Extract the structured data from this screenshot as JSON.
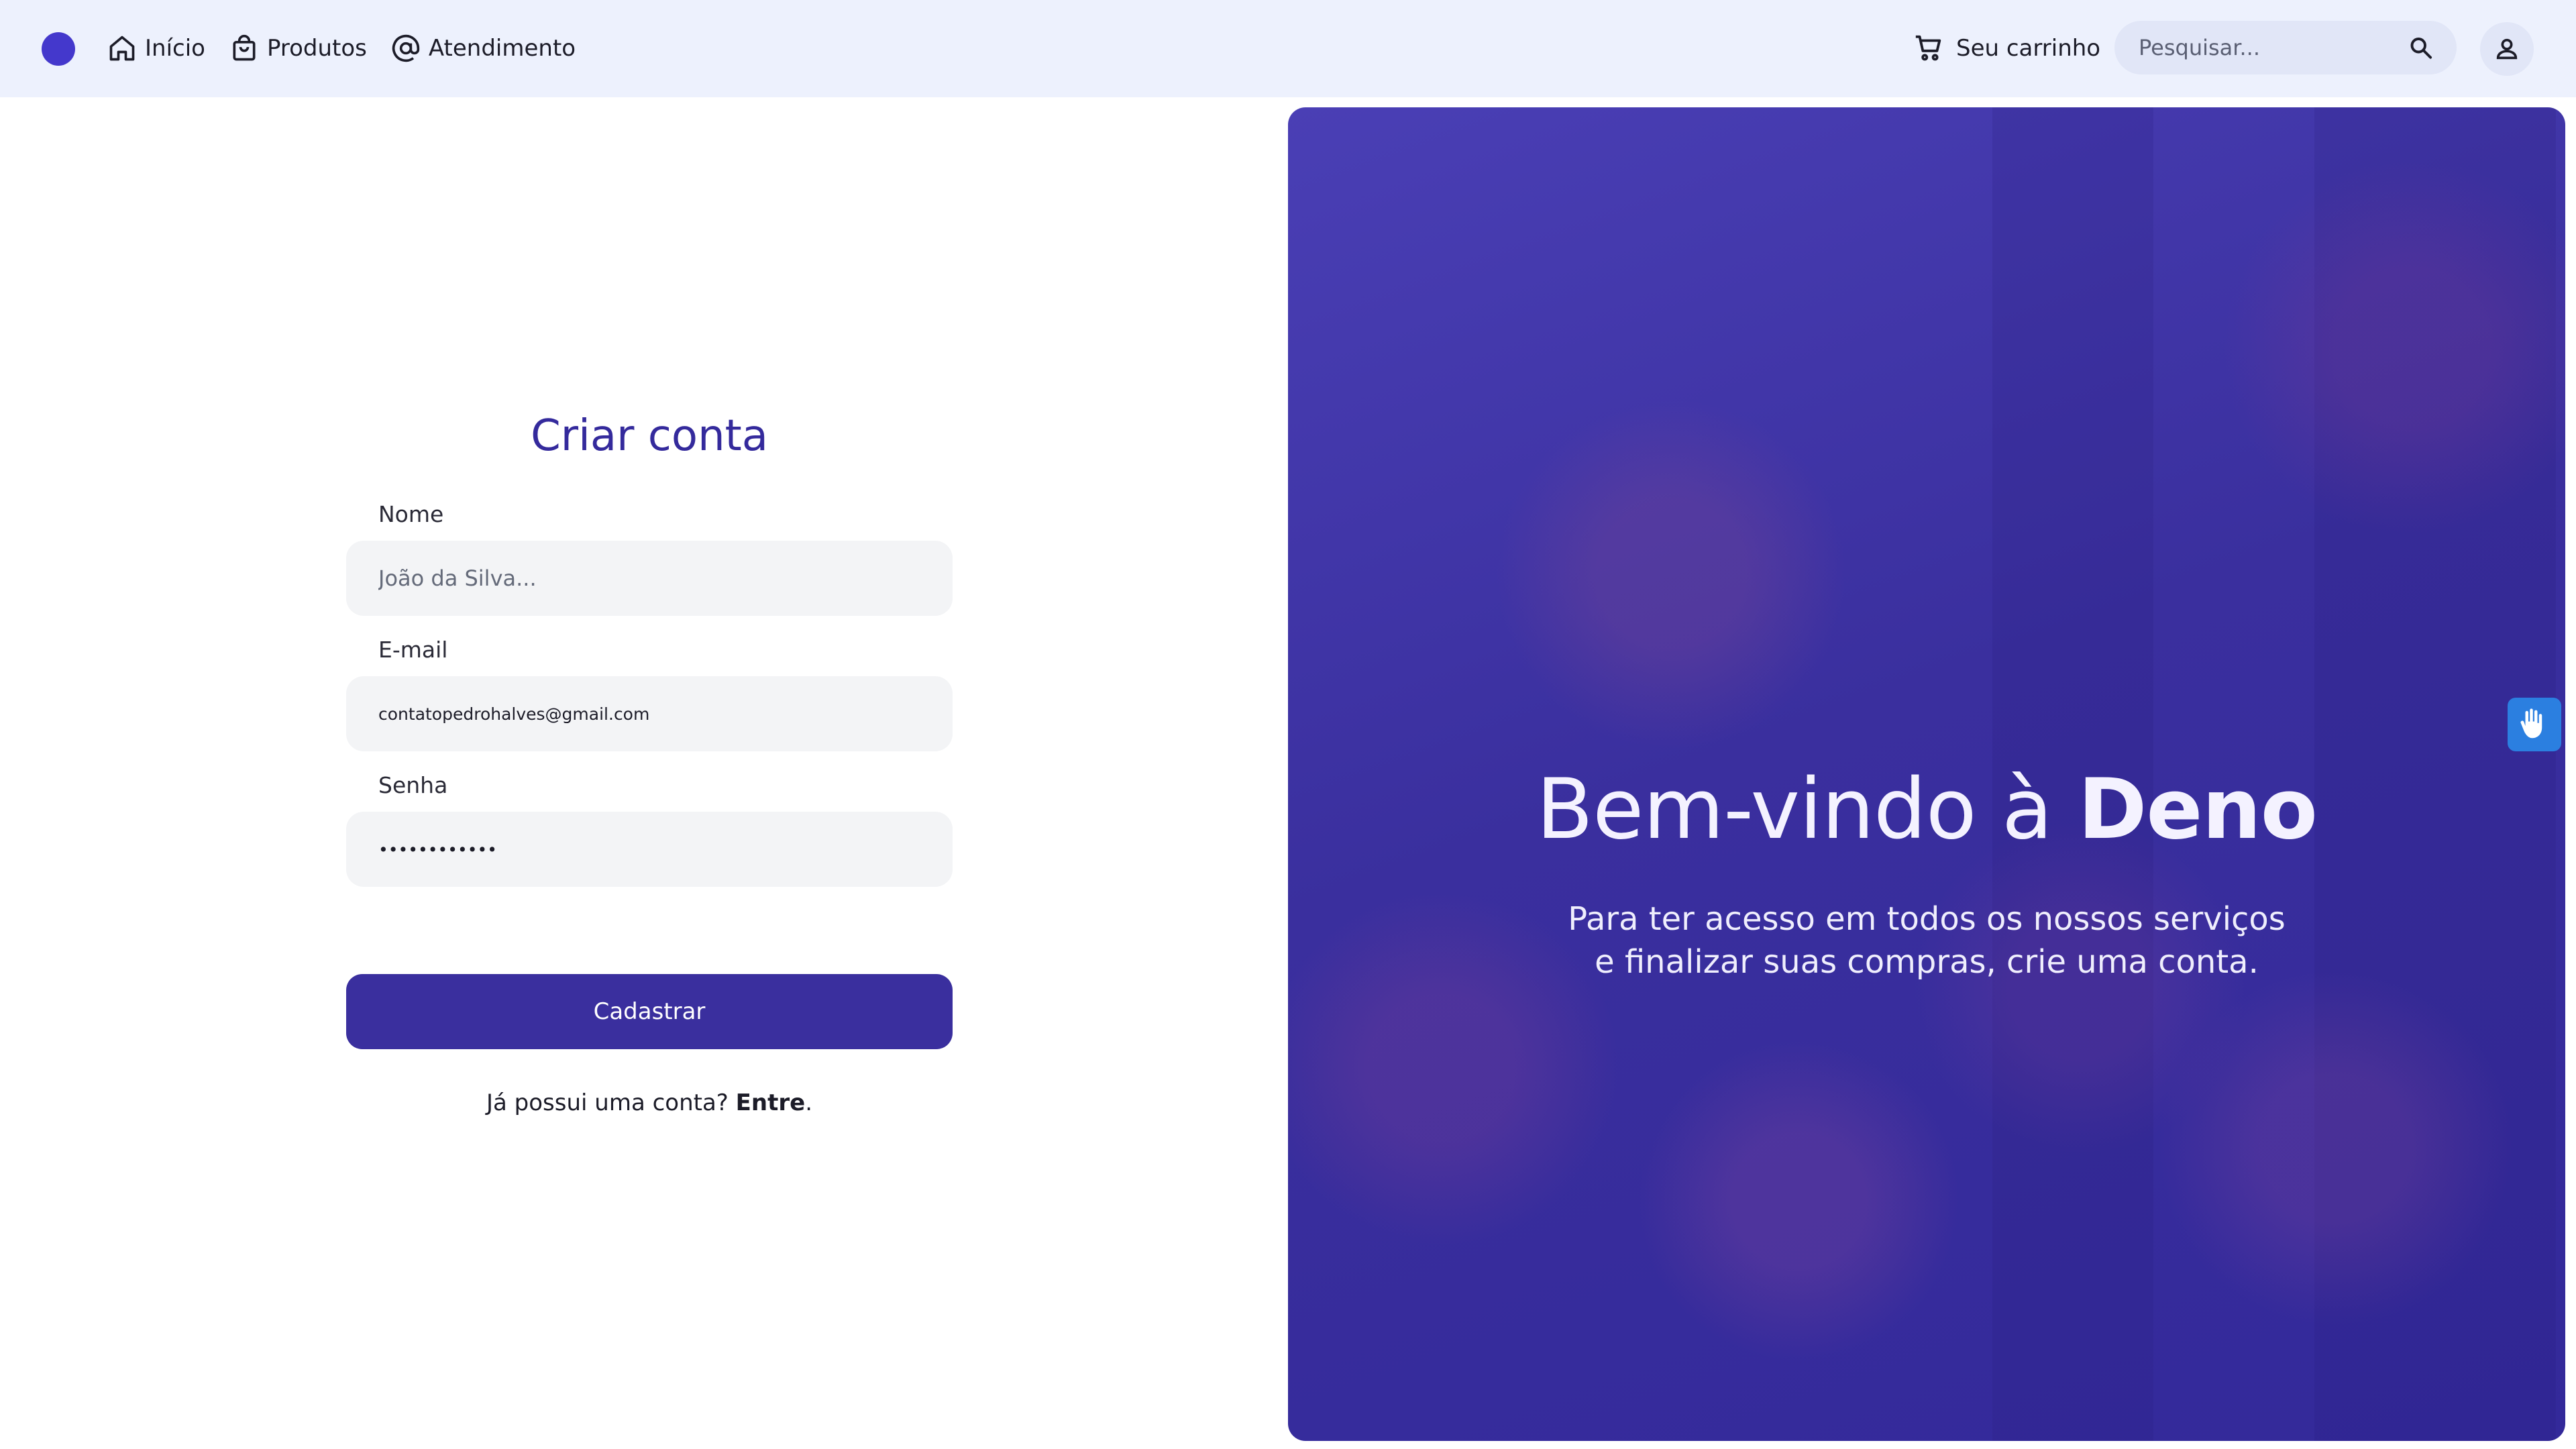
{
  "header": {
    "nav": [
      {
        "label": "Início",
        "icon": "home-icon"
      },
      {
        "label": "Produtos",
        "icon": "shopping-bag-icon"
      },
      {
        "label": "Atendimento",
        "icon": "at-sign-icon"
      }
    ],
    "cart_label": "Seu carrinho",
    "search_placeholder": "Pesquisar..."
  },
  "form": {
    "title": "Criar conta",
    "name_label": "Nome",
    "name_placeholder": "João da Silva...",
    "email_label": "E-mail",
    "email_value": "contatopedrohalves@gmail.com",
    "password_label": "Senha",
    "password_value": "••••••••••••",
    "submit_label": "Cadastrar",
    "login_prompt": "Já possui uma conta? ",
    "login_link": "Entre",
    "login_suffix": "."
  },
  "hero": {
    "title_prefix": "Bem-vindo à ",
    "title_brand": "Deno",
    "subtitle": "Para ter acesso em todos os nossos serviços e finalizar suas compras, crie uma conta."
  },
  "colors": {
    "brand": "#3a2f9e",
    "logo": "#4438cc",
    "header_bg": "#edf1fd",
    "accessibility_widget": "#2b7fe0"
  }
}
